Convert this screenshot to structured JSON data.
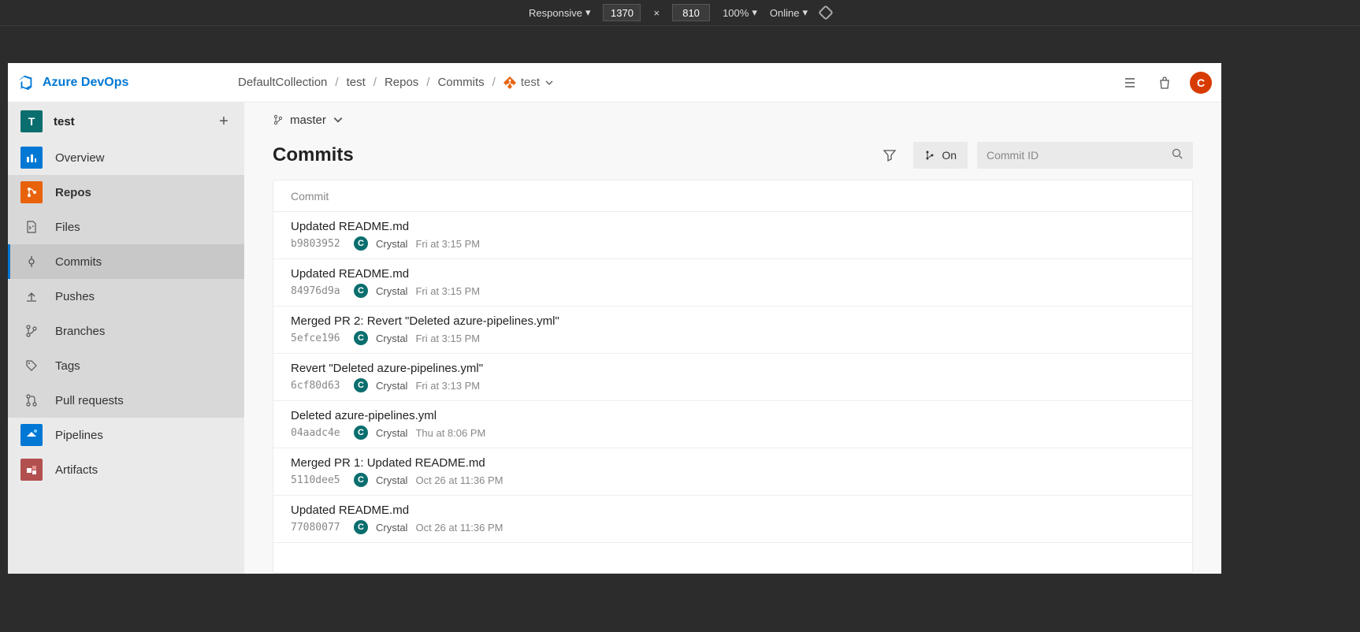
{
  "devtools": {
    "mode": "Responsive",
    "width": "1370",
    "height": "810",
    "zoom": "100%",
    "throttle": "Online"
  },
  "header": {
    "brand": "Azure DevOps",
    "avatar_letter": "C"
  },
  "breadcrumb": {
    "items": [
      "DefaultCollection",
      "test",
      "Repos",
      "Commits"
    ],
    "repo": "test"
  },
  "sidebar": {
    "project_letter": "T",
    "project_name": "test",
    "items": {
      "overview": "Overview",
      "repos": "Repos",
      "pipelines": "Pipelines",
      "artifacts": "Artifacts"
    },
    "repos_sub": {
      "files": "Files",
      "commits": "Commits",
      "pushes": "Pushes",
      "branches": "Branches",
      "tags": "Tags",
      "pull_requests": "Pull requests"
    }
  },
  "main": {
    "branch": "master",
    "title": "Commits",
    "graph_toggle": "On",
    "search_placeholder": "Commit ID",
    "column_header": "Commit",
    "commits": [
      {
        "title": "Updated README.md",
        "hash": "b9803952",
        "author": "Crystal",
        "author_initial": "C",
        "date": "Fri at 3:15 PM"
      },
      {
        "title": "Updated README.md",
        "hash": "84976d9a",
        "author": "Crystal",
        "author_initial": "C",
        "date": "Fri at 3:15 PM"
      },
      {
        "title": "Merged PR 2: Revert \"Deleted azure-pipelines.yml\"",
        "hash": "5efce196",
        "author": "Crystal",
        "author_initial": "C",
        "date": "Fri at 3:15 PM"
      },
      {
        "title": "Revert \"Deleted azure-pipelines.yml\"",
        "hash": "6cf80d63",
        "author": "Crystal",
        "author_initial": "C",
        "date": "Fri at 3:13 PM"
      },
      {
        "title": "Deleted azure-pipelines.yml",
        "hash": "04aadc4e",
        "author": "Crystal",
        "author_initial": "C",
        "date": "Thu at 8:06 PM"
      },
      {
        "title": "Merged PR 1: Updated README.md",
        "hash": "5110dee5",
        "author": "Crystal",
        "author_initial": "C",
        "date": "Oct 26 at 11:36 PM"
      },
      {
        "title": "Updated README.md",
        "hash": "77080077",
        "author": "Crystal",
        "author_initial": "C",
        "date": "Oct 26 at 11:36 PM"
      }
    ]
  }
}
